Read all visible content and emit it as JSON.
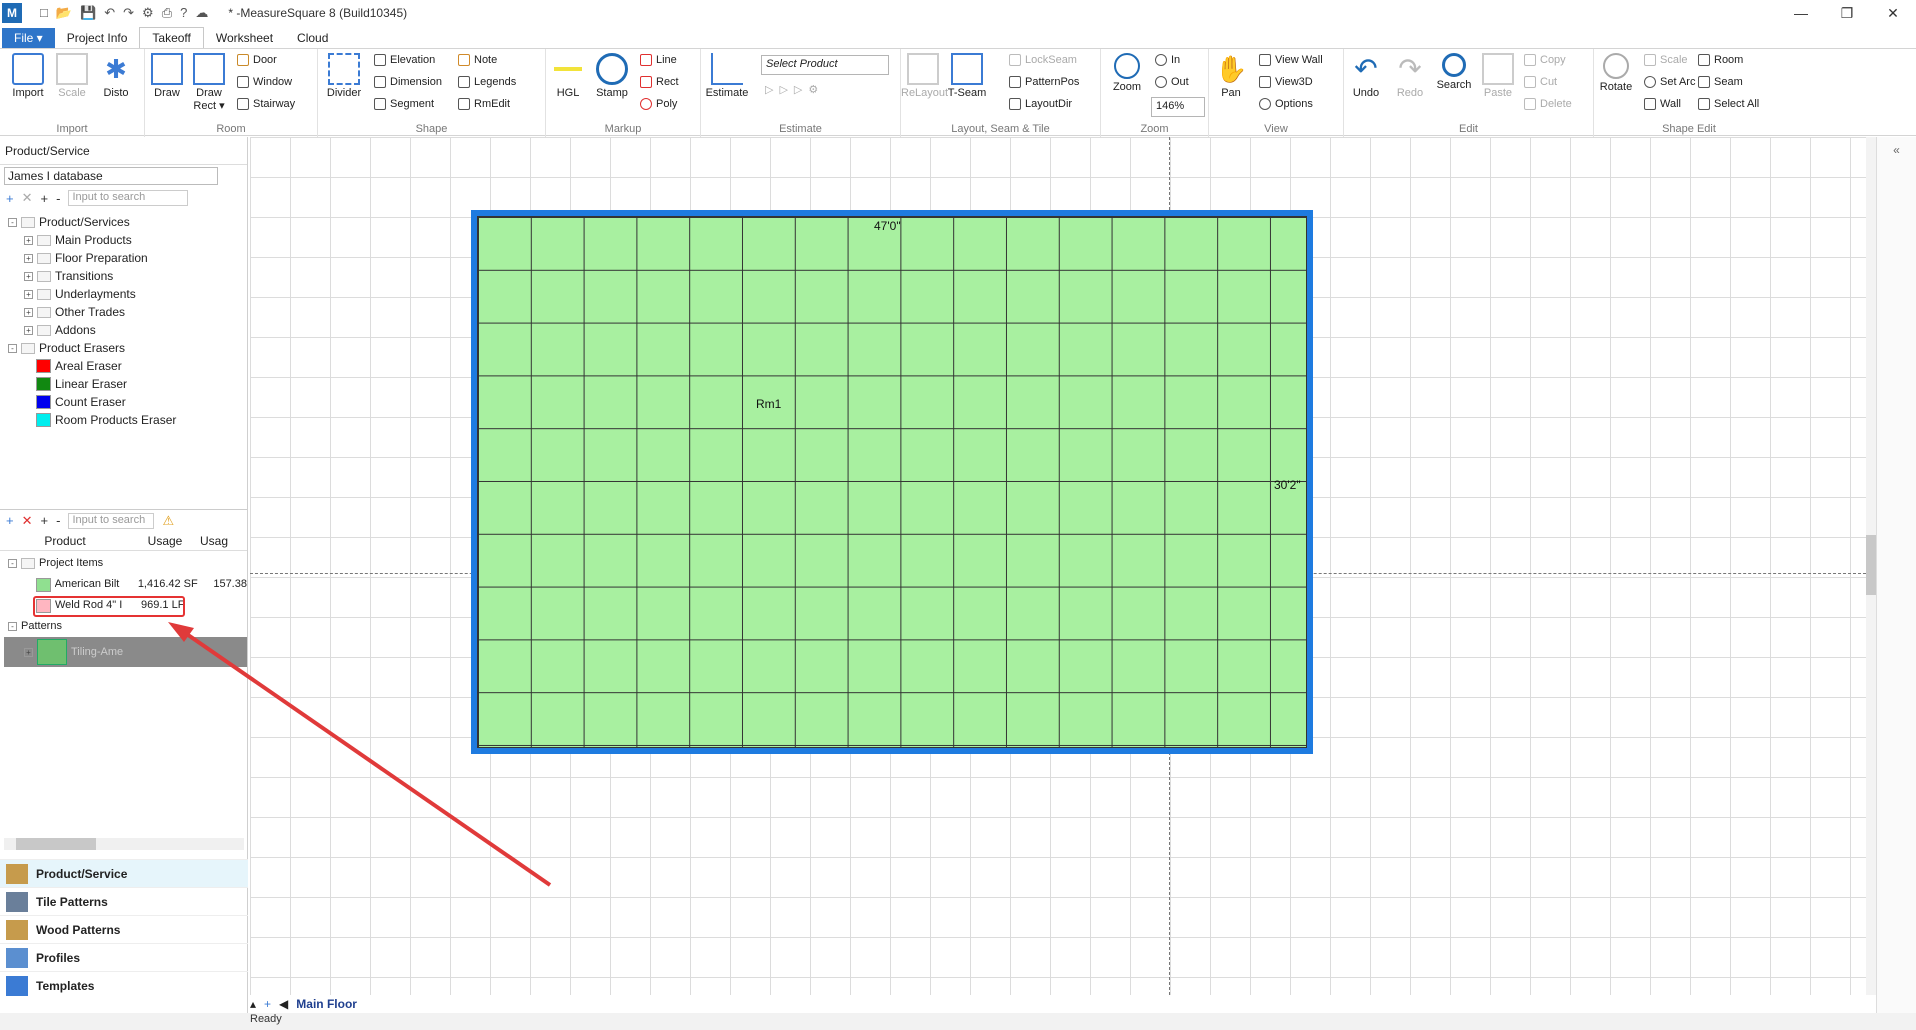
{
  "window": {
    "title": "* -MeasureSquare 8 (Build10345)"
  },
  "tabs": [
    {
      "label": "File ▾"
    },
    {
      "label": "Project Info"
    },
    {
      "label": "Takeoff"
    },
    {
      "label": "Worksheet"
    },
    {
      "label": "Cloud"
    }
  ],
  "ribbon": {
    "import": {
      "name": "Import",
      "import": "Import",
      "scale": "Scale",
      "disto": "Disto"
    },
    "room": {
      "name": "Room",
      "draw": "Draw",
      "draw_rect": "Draw Rect ▾",
      "door": "Door",
      "window": "Window",
      "stairway": "Stairway"
    },
    "shape": {
      "name": "Shape",
      "divider": "Divider",
      "elevation": "Elevation",
      "dimension": "Dimension",
      "segment": "Segment",
      "note": "Note",
      "legends": "Legends",
      "rmedit": "RmEdit"
    },
    "markup": {
      "name": "Markup",
      "hgl": "HGL",
      "stamp": "Stamp",
      "line": "Line",
      "rect": "Rect",
      "poly": "Poly"
    },
    "estimate": {
      "name": "Estimate",
      "estimate": "Estimate",
      "select_product": "Select Product"
    },
    "layout": {
      "name": "Layout, Seam & Tile",
      "relayout": "ReLayout",
      "tseam": "T-Seam",
      "lockseam": "LockSeam",
      "patternpos": "PatternPos",
      "layoutdir": "LayoutDir"
    },
    "zoom": {
      "name": "Zoom",
      "zoom": "Zoom",
      "in": "In",
      "out": "Out",
      "level": "146%"
    },
    "view": {
      "name": "View",
      "pan": "Pan",
      "view_wall": "View Wall",
      "view3d": "View3D",
      "options": "Options"
    },
    "edit": {
      "name": "Edit",
      "undo": "Undo",
      "redo": "Redo",
      "search": "Search",
      "paste": "Paste",
      "copy": "Copy",
      "cut": "Cut",
      "delete": "Delete"
    },
    "shapeedit": {
      "name": "Shape Edit",
      "rotate": "Rotate",
      "scale": "Scale",
      "set_arc": "Set Arc",
      "wall": "Wall",
      "room": "Room",
      "seam": "Seam",
      "select_all": "Select All"
    }
  },
  "leftpanel": {
    "title": "Product/Service",
    "database": "James I database",
    "search_placeholder": "Input to search",
    "tree": [
      {
        "label": "Product/Services",
        "level": 0
      },
      {
        "label": "Main Products",
        "level": 1
      },
      {
        "label": "Floor Preparation",
        "level": 1
      },
      {
        "label": "Transitions",
        "level": 1
      },
      {
        "label": "Underlayments",
        "level": 1
      },
      {
        "label": "Other Trades",
        "level": 1
      },
      {
        "label": "Addons",
        "level": 1
      },
      {
        "label": "Product Erasers",
        "level": 0
      }
    ],
    "erasers": [
      {
        "label": "Areal Eraser",
        "color": "#ff0000"
      },
      {
        "label": "Linear Eraser",
        "color": "#118811"
      },
      {
        "label": "Count Eraser",
        "color": "#0000ee"
      },
      {
        "label": "Room Products Eraser",
        "color": "#00eeee"
      }
    ],
    "project": {
      "search_placeholder": "Input to search",
      "columns": [
        "Product",
        "Usage",
        "Usag"
      ],
      "group": "Project Items",
      "items": [
        {
          "name": "American Bilt",
          "usage": "1,416.42 SF",
          "usage2": "157.38",
          "color": "#90e090"
        },
        {
          "name": "Weld Rod 4\" I",
          "usage": "969.1 LF",
          "usage2": "",
          "color": "#ffb6c1"
        }
      ],
      "patterns_label": "Patterns",
      "pattern_item": "Tiling-Ame"
    },
    "nav": [
      "Product/Service",
      "Tile Patterns",
      "Wood Patterns",
      "Profiles",
      "Templates"
    ]
  },
  "canvas": {
    "room_label": "Rm1",
    "dim_top": "47'0\"",
    "dim_right": "30'2\"",
    "fill": "#a8f0a0",
    "border": "#1e7be0"
  },
  "bottom": {
    "floor_tab": "Main Floor"
  },
  "status": {
    "text": "Ready"
  }
}
